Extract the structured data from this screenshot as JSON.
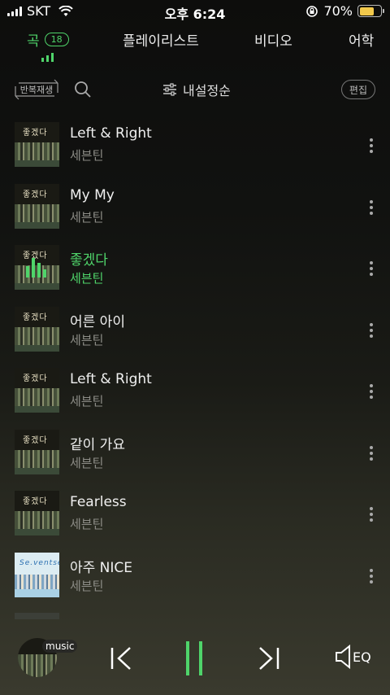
{
  "status_bar": {
    "carrier": "SKT",
    "time": "오후 6:24",
    "battery": "70%",
    "battery_level": 0.7,
    "battery_color": "#f2c94c"
  },
  "tabs": {
    "songs": "곡",
    "songs_count": "18",
    "playlist": "플레이리스트",
    "video": "비디오",
    "study": "어학"
  },
  "toolbar": {
    "repeat_label": "반복재생",
    "sort_label": "내설정순",
    "edit_label": "편집"
  },
  "songs": [
    {
      "title": "Left & Right",
      "artist": "세븐틴",
      "art": "ode"
    },
    {
      "title": "My My",
      "artist": "세븐틴",
      "art": "ode"
    },
    {
      "title": "좋겠다",
      "artist": "세븐틴",
      "art": "ode",
      "playing": true
    },
    {
      "title": "어른 아이",
      "artist": "세븐틴",
      "art": "ode"
    },
    {
      "title": "Left & Right",
      "artist": "세븐틴",
      "art": "ode"
    },
    {
      "title": "같이 가요",
      "artist": "세븐틴",
      "art": "ode"
    },
    {
      "title": "Fearless",
      "artist": "세븐틴",
      "art": "ode"
    },
    {
      "title": "아주 NICE",
      "artist": "세븐틴",
      "art": "light"
    }
  ],
  "album_art_text": {
    "ode": "좋겠다",
    "light": "Se.ventsen"
  },
  "player": {
    "source_label": "music",
    "eq_label": "EQ",
    "accent_color": "#4fd46a"
  }
}
